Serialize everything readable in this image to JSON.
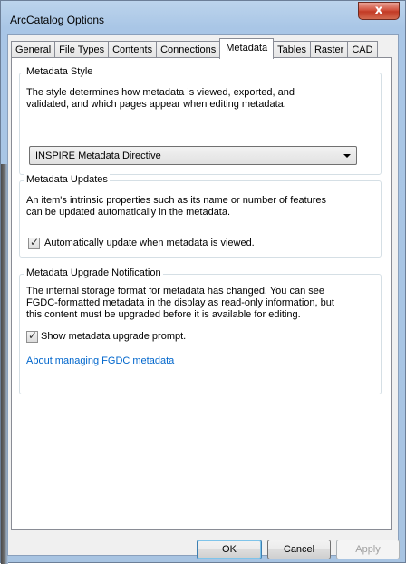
{
  "window": {
    "title": "ArcCatalog Options",
    "close_glyph": "x"
  },
  "tabs": [
    {
      "label": "General"
    },
    {
      "label": "File Types"
    },
    {
      "label": "Contents"
    },
    {
      "label": "Connections"
    },
    {
      "label": "Metadata",
      "active": true
    },
    {
      "label": "Tables"
    },
    {
      "label": "Raster"
    },
    {
      "label": "CAD"
    }
  ],
  "metadata_style": {
    "title": "Metadata Style",
    "description_line1": "The style determines how metadata is viewed, exported, and",
    "description_line2": "validated, and which pages appear when editing metadata.",
    "selected_style": "INSPIRE Metadata Directive"
  },
  "metadata_updates": {
    "title": "Metadata Updates",
    "description_line1": "An item's intrinsic properties such as its name or number of features",
    "description_line2": "can be updated automatically in the metadata.",
    "checkbox_label": "Automatically update when metadata is viewed.",
    "checked": true
  },
  "upgrade_notification": {
    "title": "Metadata Upgrade Notification",
    "description_line1": "The internal storage format for metadata has changed. You can see",
    "description_line2": "FGDC-formatted metadata in the display as read-only information, but",
    "description_line3": "this content must be upgraded before it is available for editing.",
    "checkbox_label": "Show metadata upgrade prompt.",
    "checked": true,
    "link_text": "About managing FGDC metadata"
  },
  "buttons": {
    "ok": "OK",
    "cancel": "Cancel",
    "apply": "Apply"
  },
  "colors": {
    "link": "#0066cc",
    "titlebar": "#a9c6e6",
    "close": "#c23a25"
  }
}
